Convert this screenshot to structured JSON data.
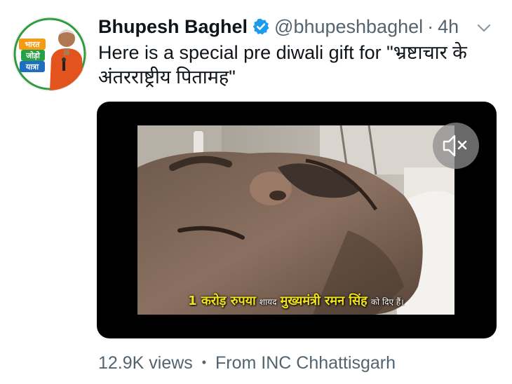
{
  "tweet": {
    "display_name": "Bhupesh Baghel",
    "handle": "@bhupeshbaghel",
    "separator": "·",
    "time": "4h",
    "text_line1": "Here is a special pre diwali gift for \"भ्रष्टाचार के",
    "text_line2": "अंतरराष्ट्रीय पितामह\"",
    "avatar_badge": {
      "line1": "भारत",
      "line2": "जोड़ो",
      "line3": "यात्रा"
    }
  },
  "media": {
    "subtitle_part1": "1 करोड़ रुपया",
    "subtitle_part2": "शायद",
    "subtitle_part3": "मुख्यमंत्री रमन सिंह",
    "subtitle_part4": "को दिए हैं।",
    "mute_icon": "speaker-muted-icon"
  },
  "footer": {
    "views": "12.9K views",
    "separator": "•",
    "source": "From INC Chhattisgarh"
  },
  "colors": {
    "text_primary": "#0f1419",
    "text_secondary": "#536471",
    "verified_blue": "#1d9bf0",
    "subtitle_yellow": "#f2e316"
  }
}
